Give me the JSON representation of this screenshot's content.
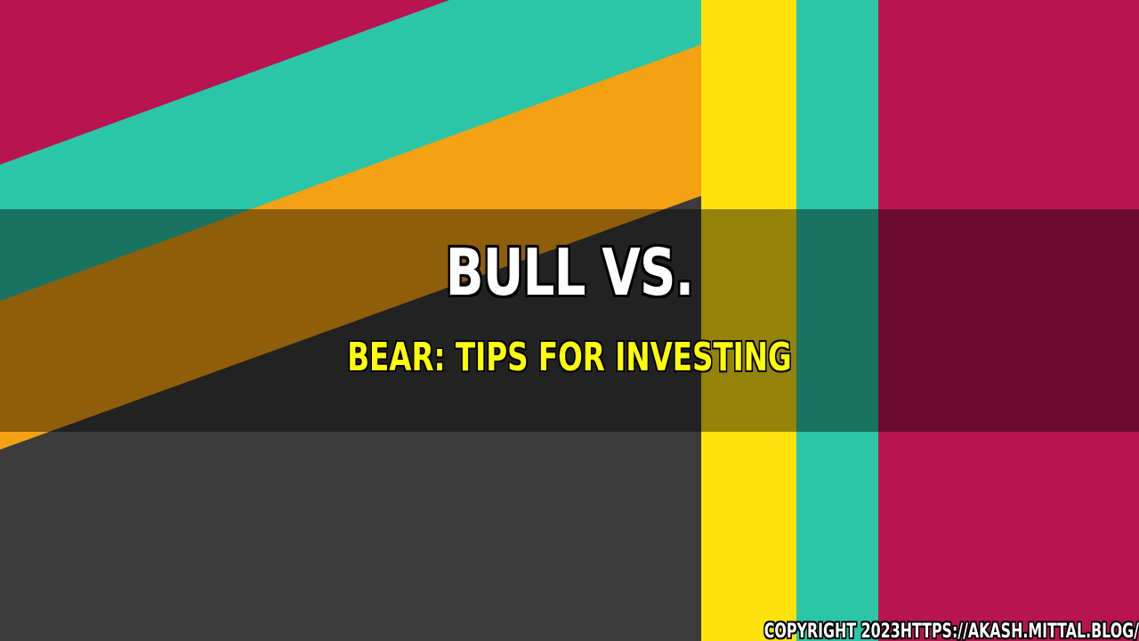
{
  "title": "BULL VS.",
  "subtitle": "BEAR: TIPS FOR INVESTING",
  "copyright": "COPYRIGHT 2023HTTPS://AKASH.MITTAL.BLOG/",
  "colors": {
    "magenta": "#b8144f",
    "teal": "#2bc6a7",
    "orange": "#f4a214",
    "yellow": "#ffe20e",
    "dark_gray": "#3c3c3c",
    "title_text": "#ffffff",
    "subtitle_text": "#ffff00"
  }
}
